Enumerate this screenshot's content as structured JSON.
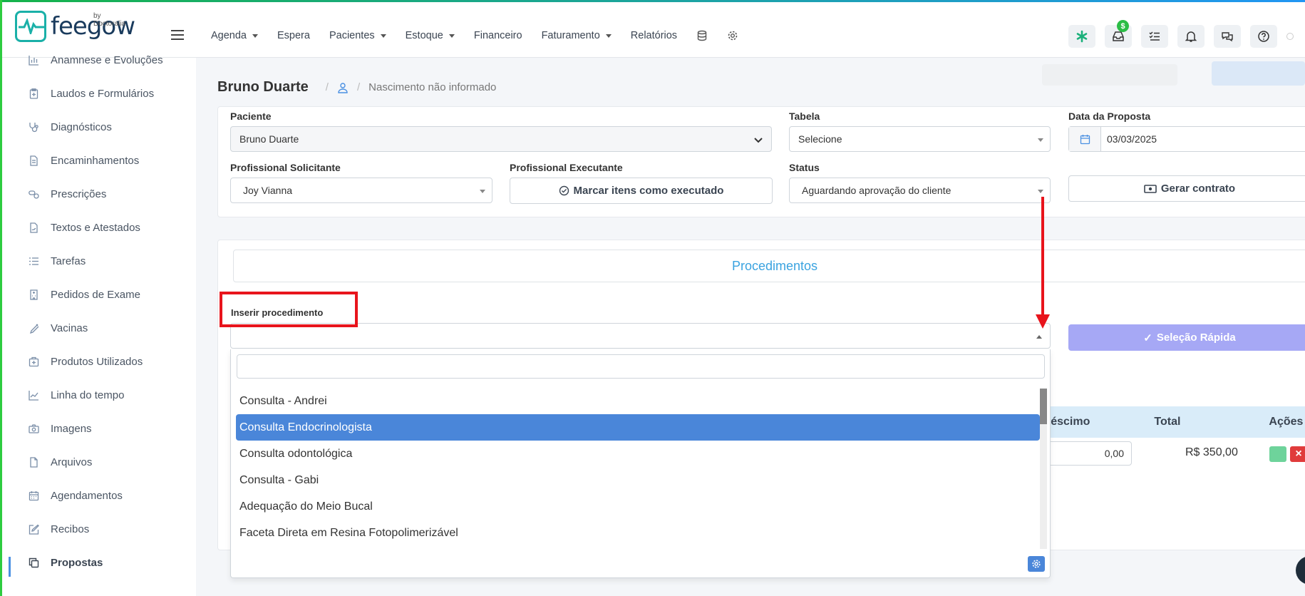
{
  "brand": {
    "name": "feegow",
    "by": "by Doctoralia"
  },
  "nav": {
    "items": [
      {
        "label": "Agenda",
        "dropdown": true
      },
      {
        "label": "Espera",
        "dropdown": false
      },
      {
        "label": "Pacientes",
        "dropdown": true
      },
      {
        "label": "Estoque",
        "dropdown": true
      },
      {
        "label": "Financeiro",
        "dropdown": false
      },
      {
        "label": "Faturamento",
        "dropdown": true
      },
      {
        "label": "Relatórios",
        "dropdown": false
      }
    ],
    "badge": "$"
  },
  "sidebar": {
    "items": [
      {
        "label": "Anamnese e Evoluções",
        "icon": "chart-icon"
      },
      {
        "label": "Laudos e Formulários",
        "icon": "clipboard-icon"
      },
      {
        "label": "Diagnósticos",
        "icon": "stethoscope-icon"
      },
      {
        "label": "Encaminhamentos",
        "icon": "document-icon"
      },
      {
        "label": "Prescrições",
        "icon": "pills-icon"
      },
      {
        "label": "Textos e Atestados",
        "icon": "file-signature-icon"
      },
      {
        "label": "Tarefas",
        "icon": "tasks-icon"
      },
      {
        "label": "Pedidos de Exame",
        "icon": "building-icon"
      },
      {
        "label": "Vacinas",
        "icon": "syringe-icon"
      },
      {
        "label": "Produtos Utilizados",
        "icon": "box-icon"
      },
      {
        "label": "Linha do tempo",
        "icon": "line-chart-icon"
      },
      {
        "label": "Imagens",
        "icon": "camera-icon"
      },
      {
        "label": "Arquivos",
        "icon": "file-icon"
      },
      {
        "label": "Agendamentos",
        "icon": "calendar-icon"
      },
      {
        "label": "Recibos",
        "icon": "edit-icon"
      },
      {
        "label": "Propostas",
        "icon": "copy-icon"
      }
    ]
  },
  "header": {
    "patient": "Bruno Duarte",
    "birth": "Nascimento não informado"
  },
  "form": {
    "paciente_label": "Paciente",
    "paciente_value": "Bruno Duarte",
    "tabela_label": "Tabela",
    "tabela_value": "Selecione",
    "data_label": "Data da Proposta",
    "data_value": "03/03/2025",
    "solicitante_label": "Profissional Solicitante",
    "solicitante_value": "Joy Vianna",
    "executante_label": "Profissional Executante",
    "executante_button": "Marcar itens como executado",
    "status_label": "Status",
    "status_value": "Aguardando aprovação do cliente",
    "contrato_button": "Gerar contrato"
  },
  "procedimentos": {
    "tab": "Procedimentos",
    "insert_label": "Inserir procedimento",
    "quick_button": "Seleção Rápida",
    "table_headers": {
      "acrescimo": "réscimo",
      "total": "Total",
      "acoes": "Ações"
    },
    "row": {
      "acrescimo": "0,00",
      "total": "R$ 350,00"
    },
    "options": [
      "Consulta - Andrei",
      "Consulta Endocrinologista",
      "Consulta odontológica",
      "Consulta - Gabi",
      "Adequação do Meio Bucal",
      "Faceta Direta em Resina Fotopolimerizável"
    ],
    "selected_index": 1
  }
}
